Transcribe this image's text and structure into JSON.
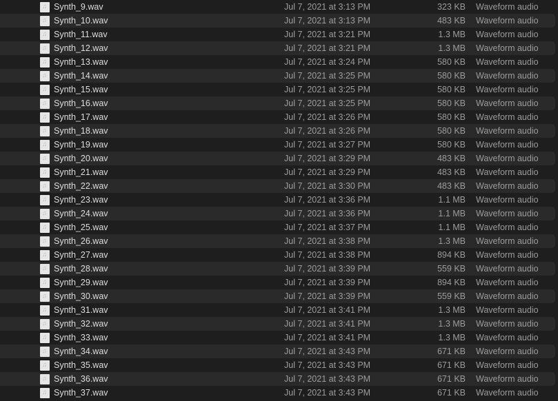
{
  "colors": {
    "background": "#1e1e1e",
    "row_alt": "#2a2a2b",
    "name_text": "#dedede",
    "secondary_text": "#9c9c9c"
  },
  "file_icon": "audio-file-icon",
  "files": [
    {
      "name": "Synth_9.wav",
      "date": "Jul 7, 2021 at 3:13 PM",
      "size": "323 KB",
      "kind": "Waveform audio"
    },
    {
      "name": "Synth_10.wav",
      "date": "Jul 7, 2021 at 3:13 PM",
      "size": "483 KB",
      "kind": "Waveform audio"
    },
    {
      "name": "Synth_11.wav",
      "date": "Jul 7, 2021 at 3:21 PM",
      "size": "1.3 MB",
      "kind": "Waveform audio"
    },
    {
      "name": "Synth_12.wav",
      "date": "Jul 7, 2021 at 3:21 PM",
      "size": "1.3 MB",
      "kind": "Waveform audio"
    },
    {
      "name": "Synth_13.wav",
      "date": "Jul 7, 2021 at 3:24 PM",
      "size": "580 KB",
      "kind": "Waveform audio"
    },
    {
      "name": "Synth_14.wav",
      "date": "Jul 7, 2021 at 3:25 PM",
      "size": "580 KB",
      "kind": "Waveform audio"
    },
    {
      "name": "Synth_15.wav",
      "date": "Jul 7, 2021 at 3:25 PM",
      "size": "580 KB",
      "kind": "Waveform audio"
    },
    {
      "name": "Synth_16.wav",
      "date": "Jul 7, 2021 at 3:25 PM",
      "size": "580 KB",
      "kind": "Waveform audio"
    },
    {
      "name": "Synth_17.wav",
      "date": "Jul 7, 2021 at 3:26 PM",
      "size": "580 KB",
      "kind": "Waveform audio"
    },
    {
      "name": "Synth_18.wav",
      "date": "Jul 7, 2021 at 3:26 PM",
      "size": "580 KB",
      "kind": "Waveform audio"
    },
    {
      "name": "Synth_19.wav",
      "date": "Jul 7, 2021 at 3:27 PM",
      "size": "580 KB",
      "kind": "Waveform audio"
    },
    {
      "name": "Synth_20.wav",
      "date": "Jul 7, 2021 at 3:29 PM",
      "size": "483 KB",
      "kind": "Waveform audio"
    },
    {
      "name": "Synth_21.wav",
      "date": "Jul 7, 2021 at 3:29 PM",
      "size": "483 KB",
      "kind": "Waveform audio"
    },
    {
      "name": "Synth_22.wav",
      "date": "Jul 7, 2021 at 3:30 PM",
      "size": "483 KB",
      "kind": "Waveform audio"
    },
    {
      "name": "Synth_23.wav",
      "date": "Jul 7, 2021 at 3:36 PM",
      "size": "1.1 MB",
      "kind": "Waveform audio"
    },
    {
      "name": "Synth_24.wav",
      "date": "Jul 7, 2021 at 3:36 PM",
      "size": "1.1 MB",
      "kind": "Waveform audio"
    },
    {
      "name": "Synth_25.wav",
      "date": "Jul 7, 2021 at 3:37 PM",
      "size": "1.1 MB",
      "kind": "Waveform audio"
    },
    {
      "name": "Synth_26.wav",
      "date": "Jul 7, 2021 at 3:38 PM",
      "size": "1.3 MB",
      "kind": "Waveform audio"
    },
    {
      "name": "Synth_27.wav",
      "date": "Jul 7, 2021 at 3:38 PM",
      "size": "894 KB",
      "kind": "Waveform audio"
    },
    {
      "name": "Synth_28.wav",
      "date": "Jul 7, 2021 at 3:39 PM",
      "size": "559 KB",
      "kind": "Waveform audio"
    },
    {
      "name": "Synth_29.wav",
      "date": "Jul 7, 2021 at 3:39 PM",
      "size": "894 KB",
      "kind": "Waveform audio"
    },
    {
      "name": "Synth_30.wav",
      "date": "Jul 7, 2021 at 3:39 PM",
      "size": "559 KB",
      "kind": "Waveform audio"
    },
    {
      "name": "Synth_31.wav",
      "date": "Jul 7, 2021 at 3:41 PM",
      "size": "1.3 MB",
      "kind": "Waveform audio"
    },
    {
      "name": "Synth_32.wav",
      "date": "Jul 7, 2021 at 3:41 PM",
      "size": "1.3 MB",
      "kind": "Waveform audio"
    },
    {
      "name": "Synth_33.wav",
      "date": "Jul 7, 2021 at 3:41 PM",
      "size": "1.3 MB",
      "kind": "Waveform audio"
    },
    {
      "name": "Synth_34.wav",
      "date": "Jul 7, 2021 at 3:43 PM",
      "size": "671 KB",
      "kind": "Waveform audio"
    },
    {
      "name": "Synth_35.wav",
      "date": "Jul 7, 2021 at 3:43 PM",
      "size": "671 KB",
      "kind": "Waveform audio"
    },
    {
      "name": "Synth_36.wav",
      "date": "Jul 7, 2021 at 3:43 PM",
      "size": "671 KB",
      "kind": "Waveform audio"
    },
    {
      "name": "Synth_37.wav",
      "date": "Jul 7, 2021 at 3:43 PM",
      "size": "671 KB",
      "kind": "Waveform audio"
    }
  ]
}
